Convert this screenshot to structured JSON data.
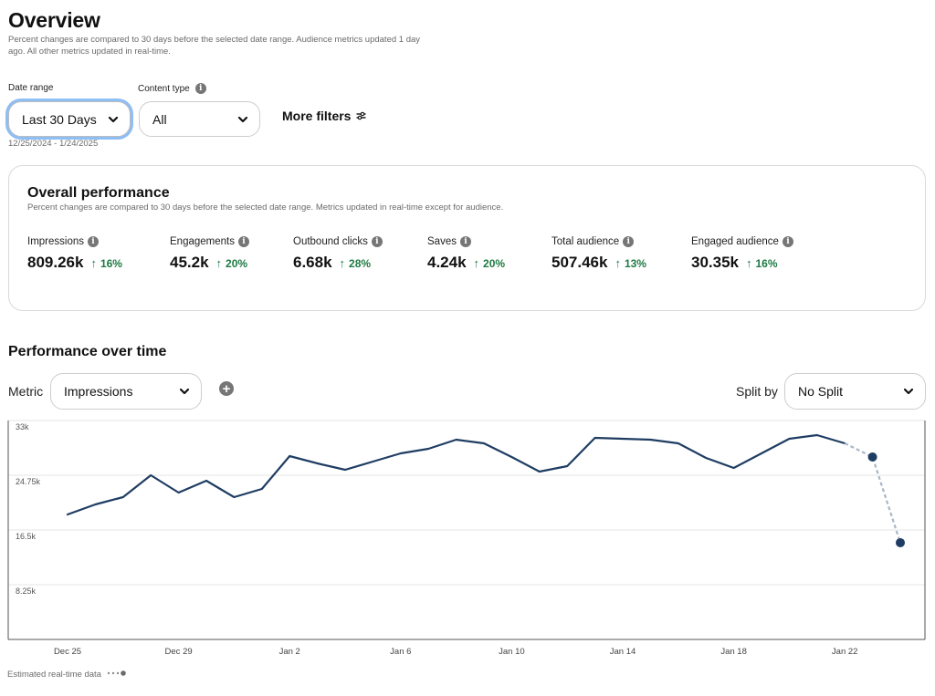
{
  "header": {
    "title": "Overview",
    "subtitle": "Percent changes are compared to 30 days before the selected date range. Audience metrics updated 1 day ago. All other metrics updated in real-time."
  },
  "filters": {
    "date_range_label": "Date range",
    "date_range_value": "Last 30 Days",
    "date_range_caption": "12/25/2024 - 1/24/2025",
    "content_type_label": "Content type",
    "content_type_value": "All",
    "more_filters_label": "More filters",
    "focus_color": "#8dbef5"
  },
  "overall_performance": {
    "title": "Overall performance",
    "subtitle": "Percent changes are compared to 30 days before the selected date range. Metrics updated in real-time except for audience.",
    "metrics": [
      {
        "label": "Impressions",
        "value": "809.26k",
        "change": "16%",
        "direction": "up"
      },
      {
        "label": "Engagements",
        "value": "45.2k",
        "change": "20%",
        "direction": "up"
      },
      {
        "label": "Outbound clicks",
        "value": "6.68k",
        "change": "28%",
        "direction": "up"
      },
      {
        "label": "Saves",
        "value": "4.24k",
        "change": "20%",
        "direction": "up"
      },
      {
        "label": "Total audience",
        "value": "507.46k",
        "change": "13%",
        "direction": "up"
      },
      {
        "label": "Engaged audience",
        "value": "30.35k",
        "change": "16%",
        "direction": "up"
      }
    ],
    "positive_color": "#1e7a43"
  },
  "performance_over_time": {
    "title": "Performance over time",
    "metric_label": "Metric",
    "metric_value": "Impressions",
    "split_label": "Split by",
    "split_value": "No Split",
    "legend_label": "Estimated real-time data"
  },
  "chart_data": {
    "type": "line",
    "title": "Performance over time",
    "series_name": "Impressions",
    "xlabel": "",
    "ylabel": "",
    "ylim": [
      0,
      33000
    ],
    "yticks": [
      {
        "value": 33000,
        "label": "33k"
      },
      {
        "value": 24750,
        "label": "24.75k"
      },
      {
        "value": 16500,
        "label": "16.5k"
      },
      {
        "value": 8250,
        "label": "8.25k"
      }
    ],
    "xtick_labels": [
      {
        "index": 0,
        "label": "Dec 25"
      },
      {
        "index": 4,
        "label": "Dec 29"
      },
      {
        "index": 8,
        "label": "Jan 2"
      },
      {
        "index": 12,
        "label": "Jan 6"
      },
      {
        "index": 16,
        "label": "Jan 10"
      },
      {
        "index": 20,
        "label": "Jan 14"
      },
      {
        "index": 24,
        "label": "Jan 18"
      },
      {
        "index": 28,
        "label": "Jan 22"
      }
    ],
    "x": [
      "Dec 25",
      "Dec 26",
      "Dec 27",
      "Dec 28",
      "Dec 29",
      "Dec 30",
      "Dec 31",
      "Jan 1",
      "Jan 2",
      "Jan 3",
      "Jan 4",
      "Jan 5",
      "Jan 6",
      "Jan 7",
      "Jan 8",
      "Jan 9",
      "Jan 10",
      "Jan 11",
      "Jan 12",
      "Jan 13",
      "Jan 14",
      "Jan 15",
      "Jan 16",
      "Jan 17",
      "Jan 18",
      "Jan 19",
      "Jan 20",
      "Jan 21",
      "Jan 22",
      "Jan 23",
      "Jan 24"
    ],
    "values": [
      18840,
      20350,
      21450,
      24750,
      22140,
      23930,
      21450,
      22690,
      27640,
      26540,
      25580,
      26810,
      28050,
      28740,
      30110,
      29560,
      27500,
      25300,
      26130,
      30390,
      30250,
      30110,
      29560,
      27360,
      25850,
      28050,
      30250,
      30800,
      29560,
      27500,
      14580
    ],
    "estimated_from_index": 28,
    "grid": true,
    "line_color": "#1f3d63",
    "estimated_color": "#a9b6c6"
  }
}
